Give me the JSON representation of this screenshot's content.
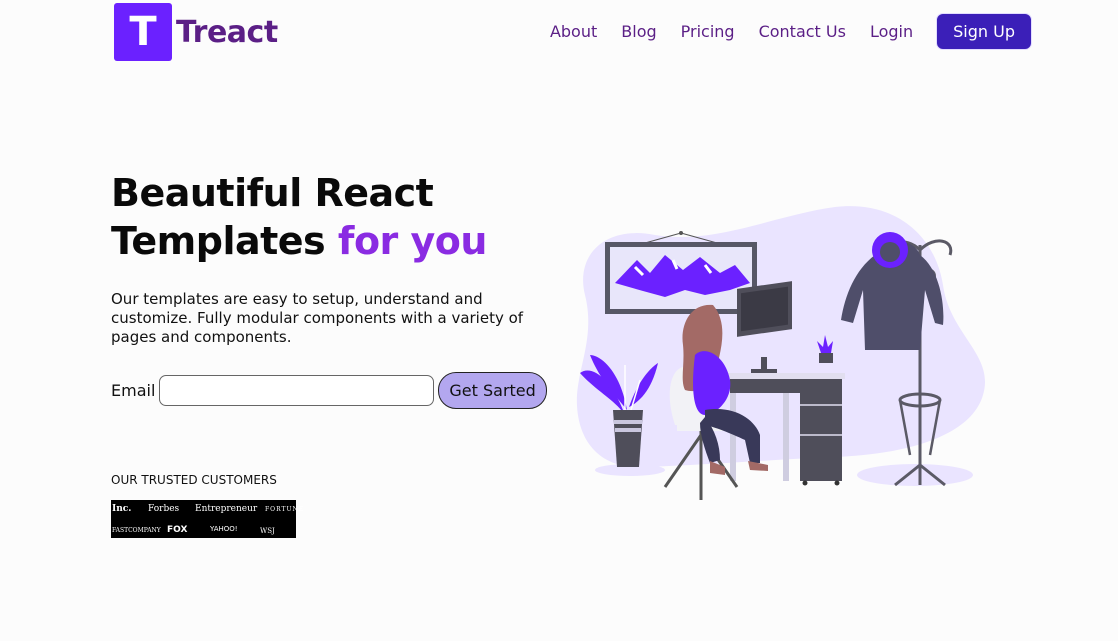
{
  "brand": {
    "letter": "T",
    "name": "Treact"
  },
  "nav": {
    "links": [
      "About",
      "Blog",
      "Pricing",
      "Contact Us",
      "Login"
    ],
    "signup_label": "Sign Up"
  },
  "hero": {
    "title_line1": "Beautiful React",
    "title_line2": "Templates",
    "title_accent": "for you",
    "description": "Our templates are easy to setup, understand and customize. Fully modular components with a variety of pages and components."
  },
  "form": {
    "email_label": "Email",
    "email_value": "",
    "button_label": "Get Sarted"
  },
  "customers": {
    "heading": "OUR TRUSTED CUSTOMERS",
    "logos": [
      "Inc.",
      "Forbes",
      "Entrepreneur",
      "FORTUNE",
      "FASTCOMPANY",
      "FOX",
      "YAHOO!",
      "WSJ"
    ]
  },
  "colors": {
    "primary": "#6b21ff",
    "brand_text": "#5b1f86",
    "accent": "#8a2be2",
    "signup_bg": "#3b1fb8",
    "cta_bg": "#b3a7ef"
  }
}
